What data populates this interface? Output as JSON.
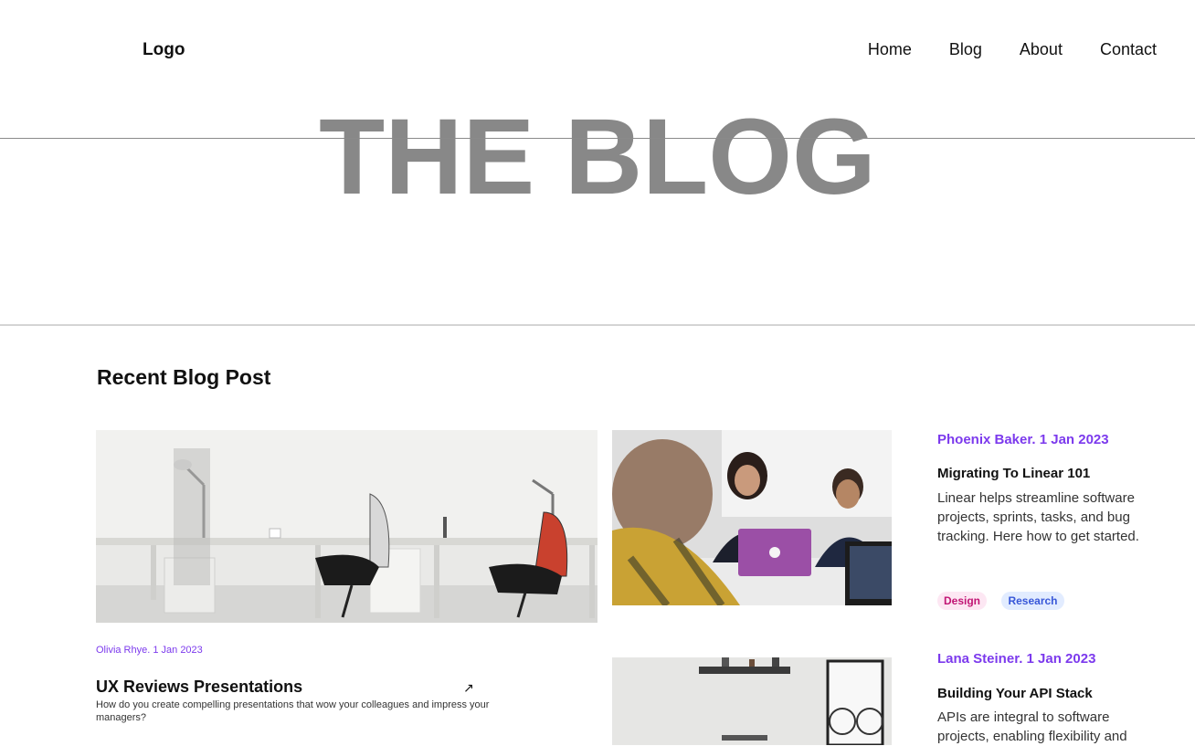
{
  "header": {
    "logo": "Logo",
    "nav": [
      "Home",
      "Blog",
      "About",
      "Contact"
    ]
  },
  "hero": {
    "title": "THE BLOG"
  },
  "section": {
    "title": "Recent Blog Post"
  },
  "featured": {
    "meta": "Olivia Rhye. 1 Jan 2023",
    "title": "UX Reviews Presentations",
    "excerpt": "How do you create compelling presentations that wow your colleagues and impress your managers?",
    "arrow_icon": "arrow-up-right-icon"
  },
  "posts": [
    {
      "meta": "Phoenix Baker. 1 Jan 2023",
      "title": "Migrating To Linear 101",
      "excerpt": "Linear helps streamline software projects, sprints, tasks, and bug tracking. Here how to get started.",
      "tags": [
        "Design",
        "Research"
      ]
    },
    {
      "meta": "Lana Steiner. 1 Jan 2023",
      "title": "Building Your API Stack",
      "excerpt": "APIs are integral to software projects, enabling flexibility and"
    }
  ],
  "colors": {
    "accent": "#7c3aed",
    "hero": "#888888"
  }
}
